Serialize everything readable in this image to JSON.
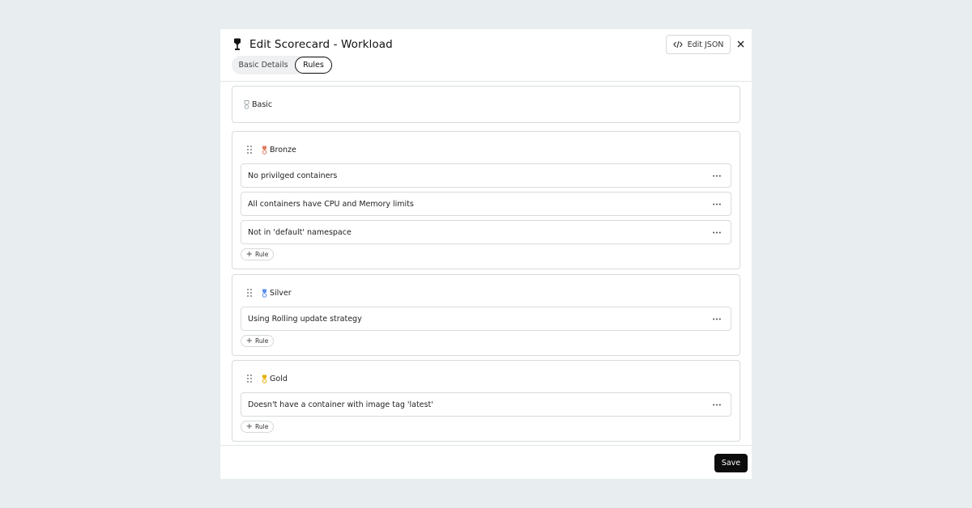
{
  "modal": {
    "title": "Edit Scorecard - Workload",
    "edit_json_label": "Edit JSON",
    "tabs": [
      {
        "label": "Basic Details",
        "active": false
      },
      {
        "label": "Rules",
        "active": true
      }
    ],
    "save_label": "Save"
  },
  "levels": {
    "basic": {
      "name": "Basic",
      "color": "#9aa3a8"
    },
    "bronze": {
      "name": "Bronze",
      "color": "#e07a5f",
      "rules": [
        "No privilged containers",
        "All containers have CPU and Memory limits",
        "Not in 'default' namespace"
      ],
      "add_rule_label": "Rule"
    },
    "silver": {
      "name": "Silver",
      "color": "#5b8def",
      "rules": [
        "Using Rolling update strategy"
      ],
      "add_rule_label": "Rule"
    },
    "gold": {
      "name": "Gold",
      "color": "#e8b004",
      "rules": [
        "Doesn't have a container with image tag 'latest'"
      ],
      "add_rule_label": "Rule"
    }
  },
  "icons": {
    "title": "trophy-icon",
    "edit_json": "code-icon",
    "close": "close-icon",
    "drag": "drag-handle-icon",
    "more": "more-horizontal-icon",
    "add": "plus-icon"
  }
}
